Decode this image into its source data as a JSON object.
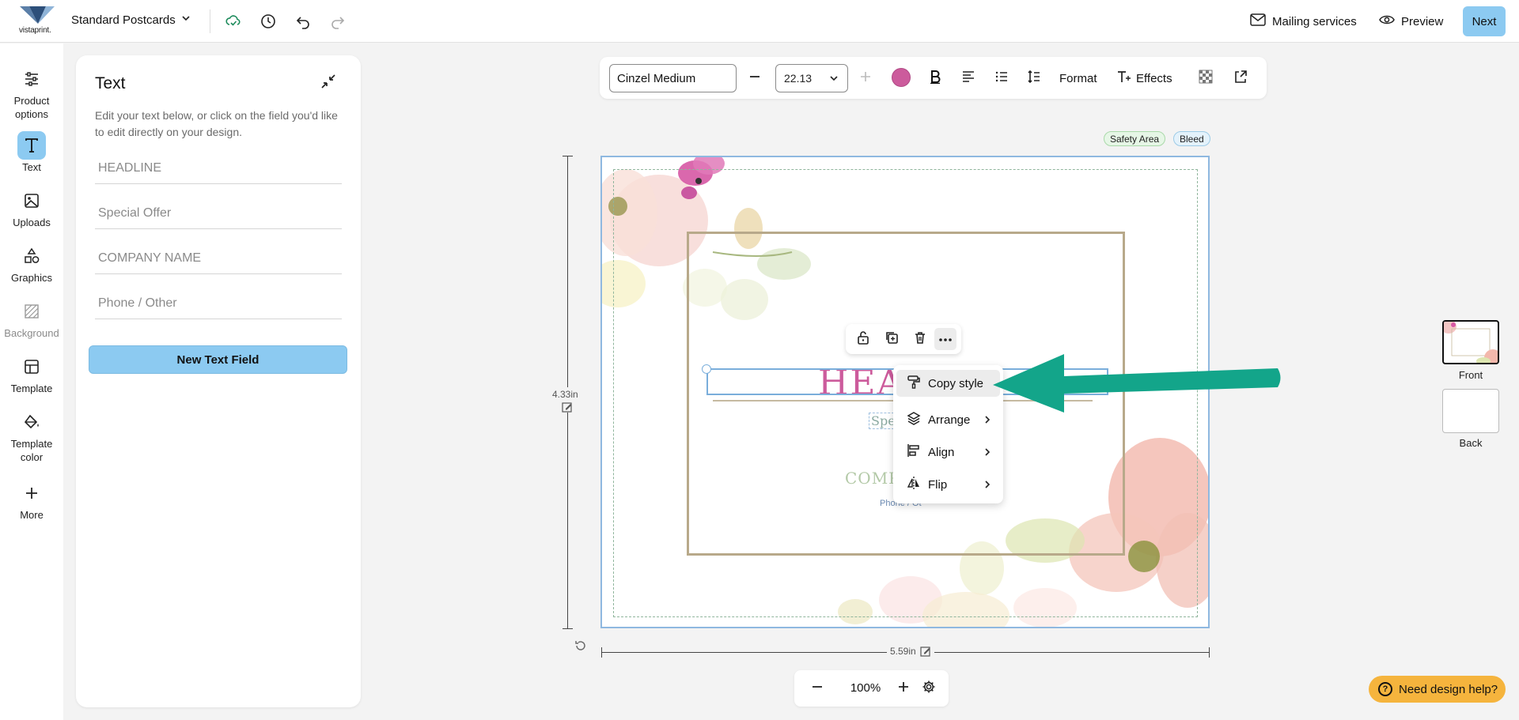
{
  "app": {
    "brand_text": "vistaprint.",
    "product_name": "Standard Postcards"
  },
  "header": {
    "mailing_label": "Mailing services",
    "preview_label": "Preview",
    "next_label": "Next"
  },
  "rail": {
    "items": [
      {
        "label": "Product options",
        "icon": "sliders-icon",
        "active": false,
        "disabled": false
      },
      {
        "label": "Text",
        "icon": "text-icon",
        "active": true,
        "disabled": false
      },
      {
        "label": "Uploads",
        "icon": "image-icon",
        "active": false,
        "disabled": false
      },
      {
        "label": "Graphics",
        "icon": "shapes-icon",
        "active": false,
        "disabled": false
      },
      {
        "label": "Background",
        "icon": "background-icon",
        "active": false,
        "disabled": true
      },
      {
        "label": "Template",
        "icon": "template-icon",
        "active": false,
        "disabled": false
      },
      {
        "label": "Template color",
        "icon": "paint-bucket-icon",
        "active": false,
        "disabled": false
      },
      {
        "label": "More",
        "icon": "plus-icon",
        "active": false,
        "disabled": false
      }
    ]
  },
  "panel": {
    "title": "Text",
    "description": "Edit your text below, or click on the field you'd like to edit directly on your design.",
    "fields": [
      "HEADLINE",
      "Special Offer",
      "COMPANY NAME",
      "Phone / Other"
    ],
    "new_field_label": "New Text Field"
  },
  "toolbar": {
    "font": "Cinzel Medium",
    "size": "22.13",
    "color": "#cc5b9c",
    "format_label": "Format",
    "effects_label": "Effects"
  },
  "canvas": {
    "safety_label": "Safety Area",
    "bleed_label": "Bleed",
    "height_label": "4.33in",
    "width_label": "5.59in",
    "headline": "HEA",
    "special": "Spe",
    "company": "COMPA",
    "phone": "Phone / Ot"
  },
  "context_menu": {
    "items": [
      {
        "label": "Copy style",
        "icon": "paint-roller-icon",
        "submenu": false,
        "active": true
      },
      {
        "label": "Arrange",
        "icon": "layers-icon",
        "submenu": true,
        "active": false
      },
      {
        "label": "Align",
        "icon": "align-icon",
        "submenu": true,
        "active": false
      },
      {
        "label": "Flip",
        "icon": "flip-icon",
        "submenu": true,
        "active": false
      }
    ]
  },
  "sides": {
    "front_label": "Front",
    "back_label": "Back"
  },
  "zoom": {
    "value": "100%"
  },
  "help": {
    "label": "Need design help?",
    "glyph": "?"
  },
  "colors": {
    "accent": "#8ccaf1",
    "annotation_arrow": "#13a58a",
    "help_button": "#f5b43d"
  }
}
